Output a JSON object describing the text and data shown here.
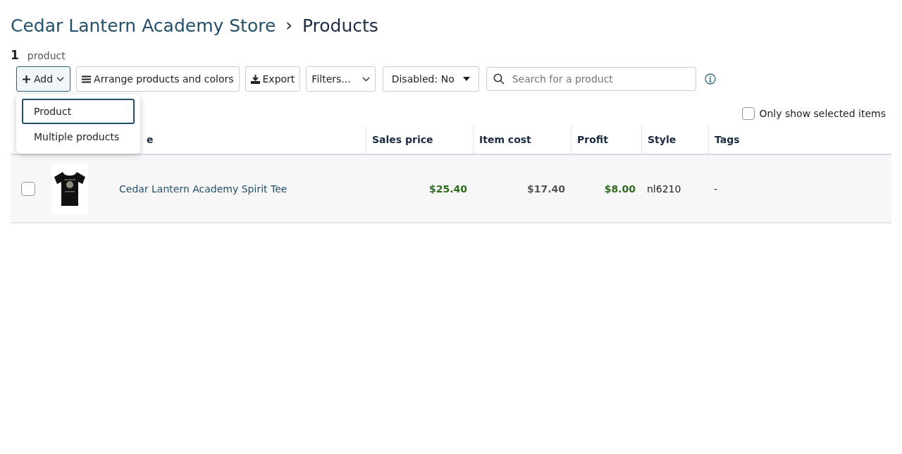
{
  "breadcrumb": {
    "store": "Cedar Lantern Academy Store",
    "separator": "›",
    "page": "Products"
  },
  "count": {
    "number": "1",
    "label": "product"
  },
  "toolbar": {
    "add": "Add",
    "arrange": "Arrange products and colors",
    "export": "Export",
    "filters": "Filters...",
    "disabled": "Disabled: No",
    "search": {
      "placeholder": "Search for a product"
    }
  },
  "add_menu": {
    "expanded": true,
    "items": [
      {
        "label": "Product",
        "selected": true
      },
      {
        "label": "Multiple products",
        "selected": false
      }
    ]
  },
  "only_selected": {
    "label": "Only show selected items",
    "checked": false
  },
  "table": {
    "columns": [
      "e",
      "Sales price",
      "Item cost",
      "Profit",
      "Style",
      "Tags"
    ],
    "rows": [
      {
        "checked": false,
        "name": "Cedar Lantern Academy Spirit Tee",
        "sales_price": "$25.40",
        "item_cost": "$17.40",
        "profit": "$8.00",
        "style": "nl6210",
        "tags": "-"
      }
    ]
  }
}
